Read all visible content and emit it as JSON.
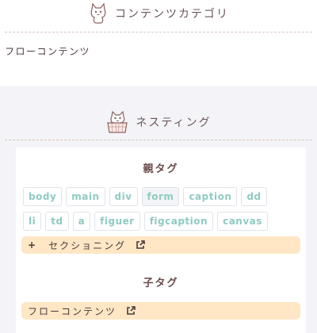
{
  "content_category": {
    "title": "コンテンツカテゴリ",
    "item": "フローコンテンツ"
  },
  "nesting": {
    "title": "ネスティング",
    "parent": {
      "title": "親タグ",
      "tags": [
        "body",
        "main",
        "div",
        "form",
        "caption",
        "dd",
        "li",
        "td",
        "a",
        "figuer",
        "figcaption",
        "canvas"
      ],
      "active_tag": "form",
      "sectioning_link": "セクショニング",
      "plus": "+"
    },
    "child": {
      "title": "子タグ",
      "link": "フローコンテンツ"
    }
  },
  "colors": {
    "tag_text": "#8fcbc2",
    "bar_bg": "#ffe6c4",
    "page_bg": "#f4f4f8"
  },
  "icons": [
    "cat-icon",
    "cat-basket-icon",
    "external-link-icon"
  ]
}
